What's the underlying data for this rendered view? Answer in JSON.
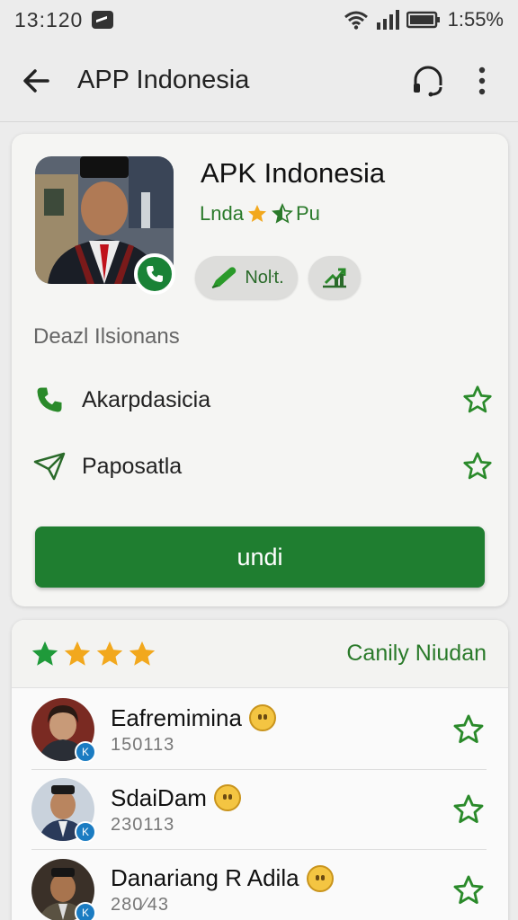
{
  "status_bar": {
    "time": "13:120",
    "battery_text": "1:55%"
  },
  "app_bar": {
    "title": "APP Indonesia"
  },
  "app_card": {
    "name": "APK Indonesia",
    "rating_prefix": "Lnda",
    "rating_suffix": "Pu",
    "chip_note_label": "Noŀt.",
    "section_title": "Deazl Ilsionans",
    "details": [
      {
        "label": "Akarpdasicia",
        "icon": "phone-icon"
      },
      {
        "label": "Paposatla",
        "icon": "send-icon"
      }
    ],
    "primary_button_label": "undi"
  },
  "reviews": {
    "star_count": 4,
    "link_label": "Canily Niudan",
    "items": [
      {
        "name": "Eafremimina",
        "date": "150113"
      },
      {
        "name": "SdaiDam",
        "date": "230113"
      },
      {
        "name": "Danariang R Adila",
        "date": "280⁄43"
      }
    ]
  },
  "colors": {
    "accent_green": "#1f7e30",
    "text_green": "#2a7a2a",
    "star_gold": "#f2a81d",
    "star_green": "#1f9a3a"
  }
}
